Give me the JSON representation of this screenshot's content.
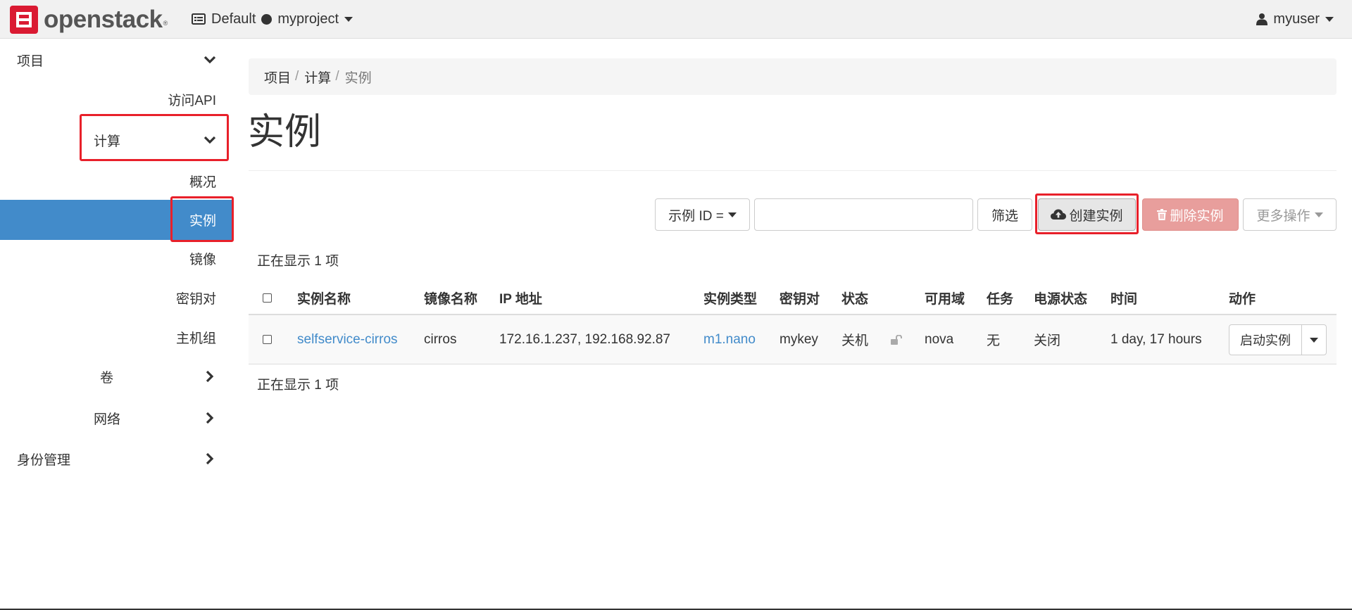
{
  "header": {
    "logo_text": "openstack",
    "logo_tm": "®",
    "domain": "Default",
    "project": "myproject",
    "user": "myuser"
  },
  "sidebar": {
    "project": "项目",
    "api_access": "访问API",
    "compute": "计算",
    "overview": "概况",
    "instances": "实例",
    "images": "镜像",
    "key_pairs": "密钥对",
    "server_groups": "主机组",
    "volumes": "卷",
    "network": "网络",
    "identity": "身份管理"
  },
  "breadcrumb": [
    "项目",
    "计算",
    "实例"
  ],
  "page_title": "实例",
  "toolbar": {
    "filter_field": "示例 ID =",
    "filter_value": "",
    "filter_button": "筛选",
    "create_button": "创建实例",
    "delete_button": "删除实例",
    "more_button": "更多操作"
  },
  "count_text": "正在显示 1 项",
  "table": {
    "columns": [
      "实例名称",
      "镜像名称",
      "IP 地址",
      "实例类型",
      "密钥对",
      "状态",
      "可用域",
      "任务",
      "电源状态",
      "时间",
      "动作"
    ],
    "rows": [
      {
        "name": "selfservice-cirros",
        "image": "cirros",
        "ip": "172.16.1.237, 192.168.92.87",
        "flavor": "m1.nano",
        "key_pair": "mykey",
        "status": "关机",
        "availability_zone": "nova",
        "task": "无",
        "power_state": "关闭",
        "age": "1 day, 17 hours",
        "action": "启动实例"
      }
    ]
  },
  "colors": {
    "accent": "#428bca",
    "highlight": "#e8202a",
    "danger": "#e89e9c",
    "logo": "#da1a32"
  }
}
